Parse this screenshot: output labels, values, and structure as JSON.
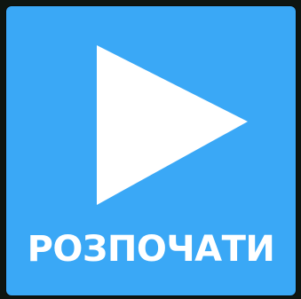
{
  "start_button": {
    "label": "РОЗПОЧАТИ",
    "icon": "play-icon"
  },
  "colors": {
    "tile": "#3aa8f6",
    "icon": "#ffffff",
    "label": "#ffffff",
    "background": "#0e1511"
  }
}
